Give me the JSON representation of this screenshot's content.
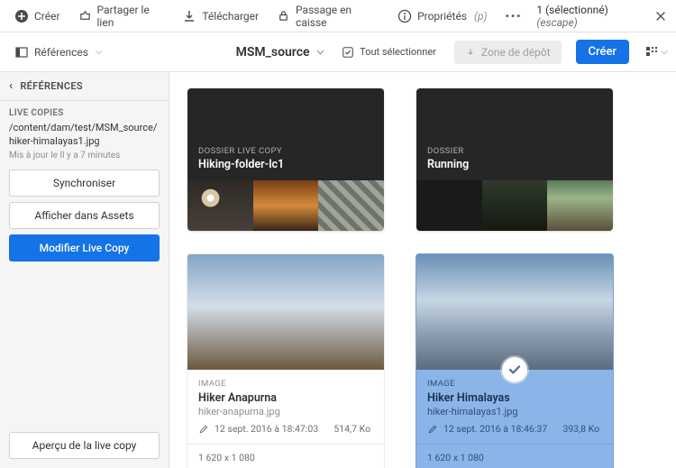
{
  "toolbar": {
    "create": "Créer",
    "share": "Partager le lien",
    "download": "Télécharger",
    "checkout": "Passage en caisse",
    "properties": "Propriétés",
    "properties_hint": "(p)",
    "more": "•••",
    "selection": "1 (sélectionné)",
    "escape": "(escape)"
  },
  "secondary": {
    "references": "Références",
    "breadcrumb": "MSM_source",
    "select_all": "Tout sélectionner",
    "dropzone": "Zone de dépôt",
    "create": "Créer"
  },
  "sidebar": {
    "title": "RÉFÉRENCES",
    "section": "LIVE COPIES",
    "path": "/content/dam/test/MSM_source/hiker-himalayas1.jpg",
    "updated": "Mis à jour le Il y a 7 minutes",
    "sync": "Synchroniser",
    "show_assets": "Afficher dans Assets",
    "modify": "Modifier Live Copy",
    "preview": "Aperçu de la live copy"
  },
  "folders": [
    {
      "label": "DOSSIER LIVE COPY",
      "name": "Hiking-folder-lc1"
    },
    {
      "label": "DOSSIER",
      "name": "Running"
    }
  ],
  "assets": [
    {
      "type": "IMAGE",
      "title": "Hiker Anapurna",
      "file": "hiker-anapurna.jpg",
      "date": "12 sept. 2016 à 18:47:03",
      "size": "514,7 Ko",
      "dims": "1 620 x 1 080",
      "selected": false
    },
    {
      "type": "IMAGE",
      "title": "Hiker Himalayas",
      "file": "hiker-himalayas1.jpg",
      "date": "12 sept. 2016 à 18:46:37",
      "size": "393,8 Ko",
      "dims": "1 620 x 1 080",
      "selected": true
    }
  ]
}
